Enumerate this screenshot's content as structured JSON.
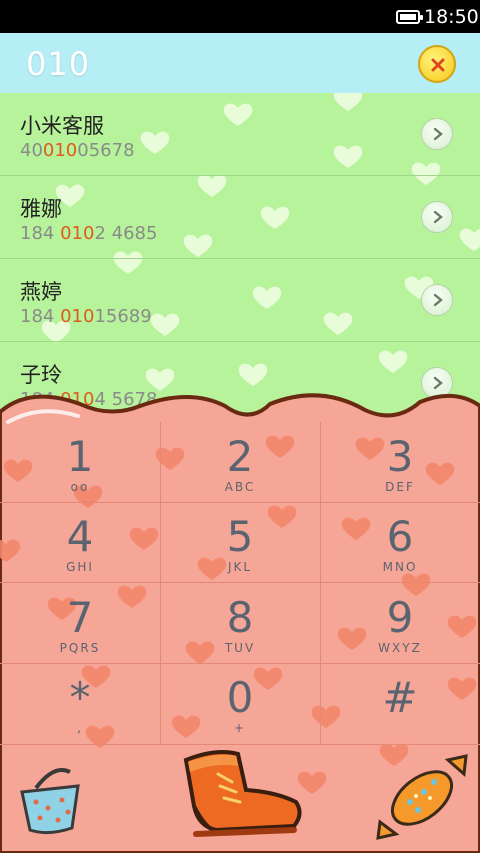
{
  "status_bar": {
    "time": "18:50",
    "battery_icon": "battery-full-icon"
  },
  "search": {
    "query": "010",
    "clear_icon": "close-icon"
  },
  "contacts": [
    {
      "name": "小米客服",
      "number_pre": "40",
      "number_match": "010",
      "number_post": "05678"
    },
    {
      "name": "雅娜",
      "number_pre": "184 ",
      "number_match": "010",
      "number_post": "2 4685"
    },
    {
      "name": "燕婷",
      "number_pre": "184 ",
      "number_match": "010",
      "number_post": "15689"
    },
    {
      "name": "子玲",
      "number_pre": "184 ",
      "number_match": "010",
      "number_post": "4 5678"
    }
  ],
  "keypad": {
    "keys": [
      {
        "digit": "1",
        "letters": "ᴏᴏ"
      },
      {
        "digit": "2",
        "letters": "ABC"
      },
      {
        "digit": "3",
        "letters": "DEF"
      },
      {
        "digit": "4",
        "letters": "GHI"
      },
      {
        "digit": "5",
        "letters": "JKL"
      },
      {
        "digit": "6",
        "letters": "MNO"
      },
      {
        "digit": "7",
        "letters": "PQRS"
      },
      {
        "digit": "8",
        "letters": "TUV"
      },
      {
        "digit": "9",
        "letters": "WXYZ"
      },
      {
        "digit": "*",
        "letters": ","
      },
      {
        "digit": "0",
        "letters": "+"
      },
      {
        "digit": "#",
        "letters": ""
      }
    ]
  },
  "actions": {
    "left_icon": "basket-icon",
    "center_icon": "boot-call-icon",
    "right_icon": "candy-delete-icon"
  },
  "colors": {
    "list_bg": "#b7f39b",
    "search_bg": "#b6eef5",
    "keypad_bg": "#f6a696",
    "match": "#e05a1e"
  }
}
